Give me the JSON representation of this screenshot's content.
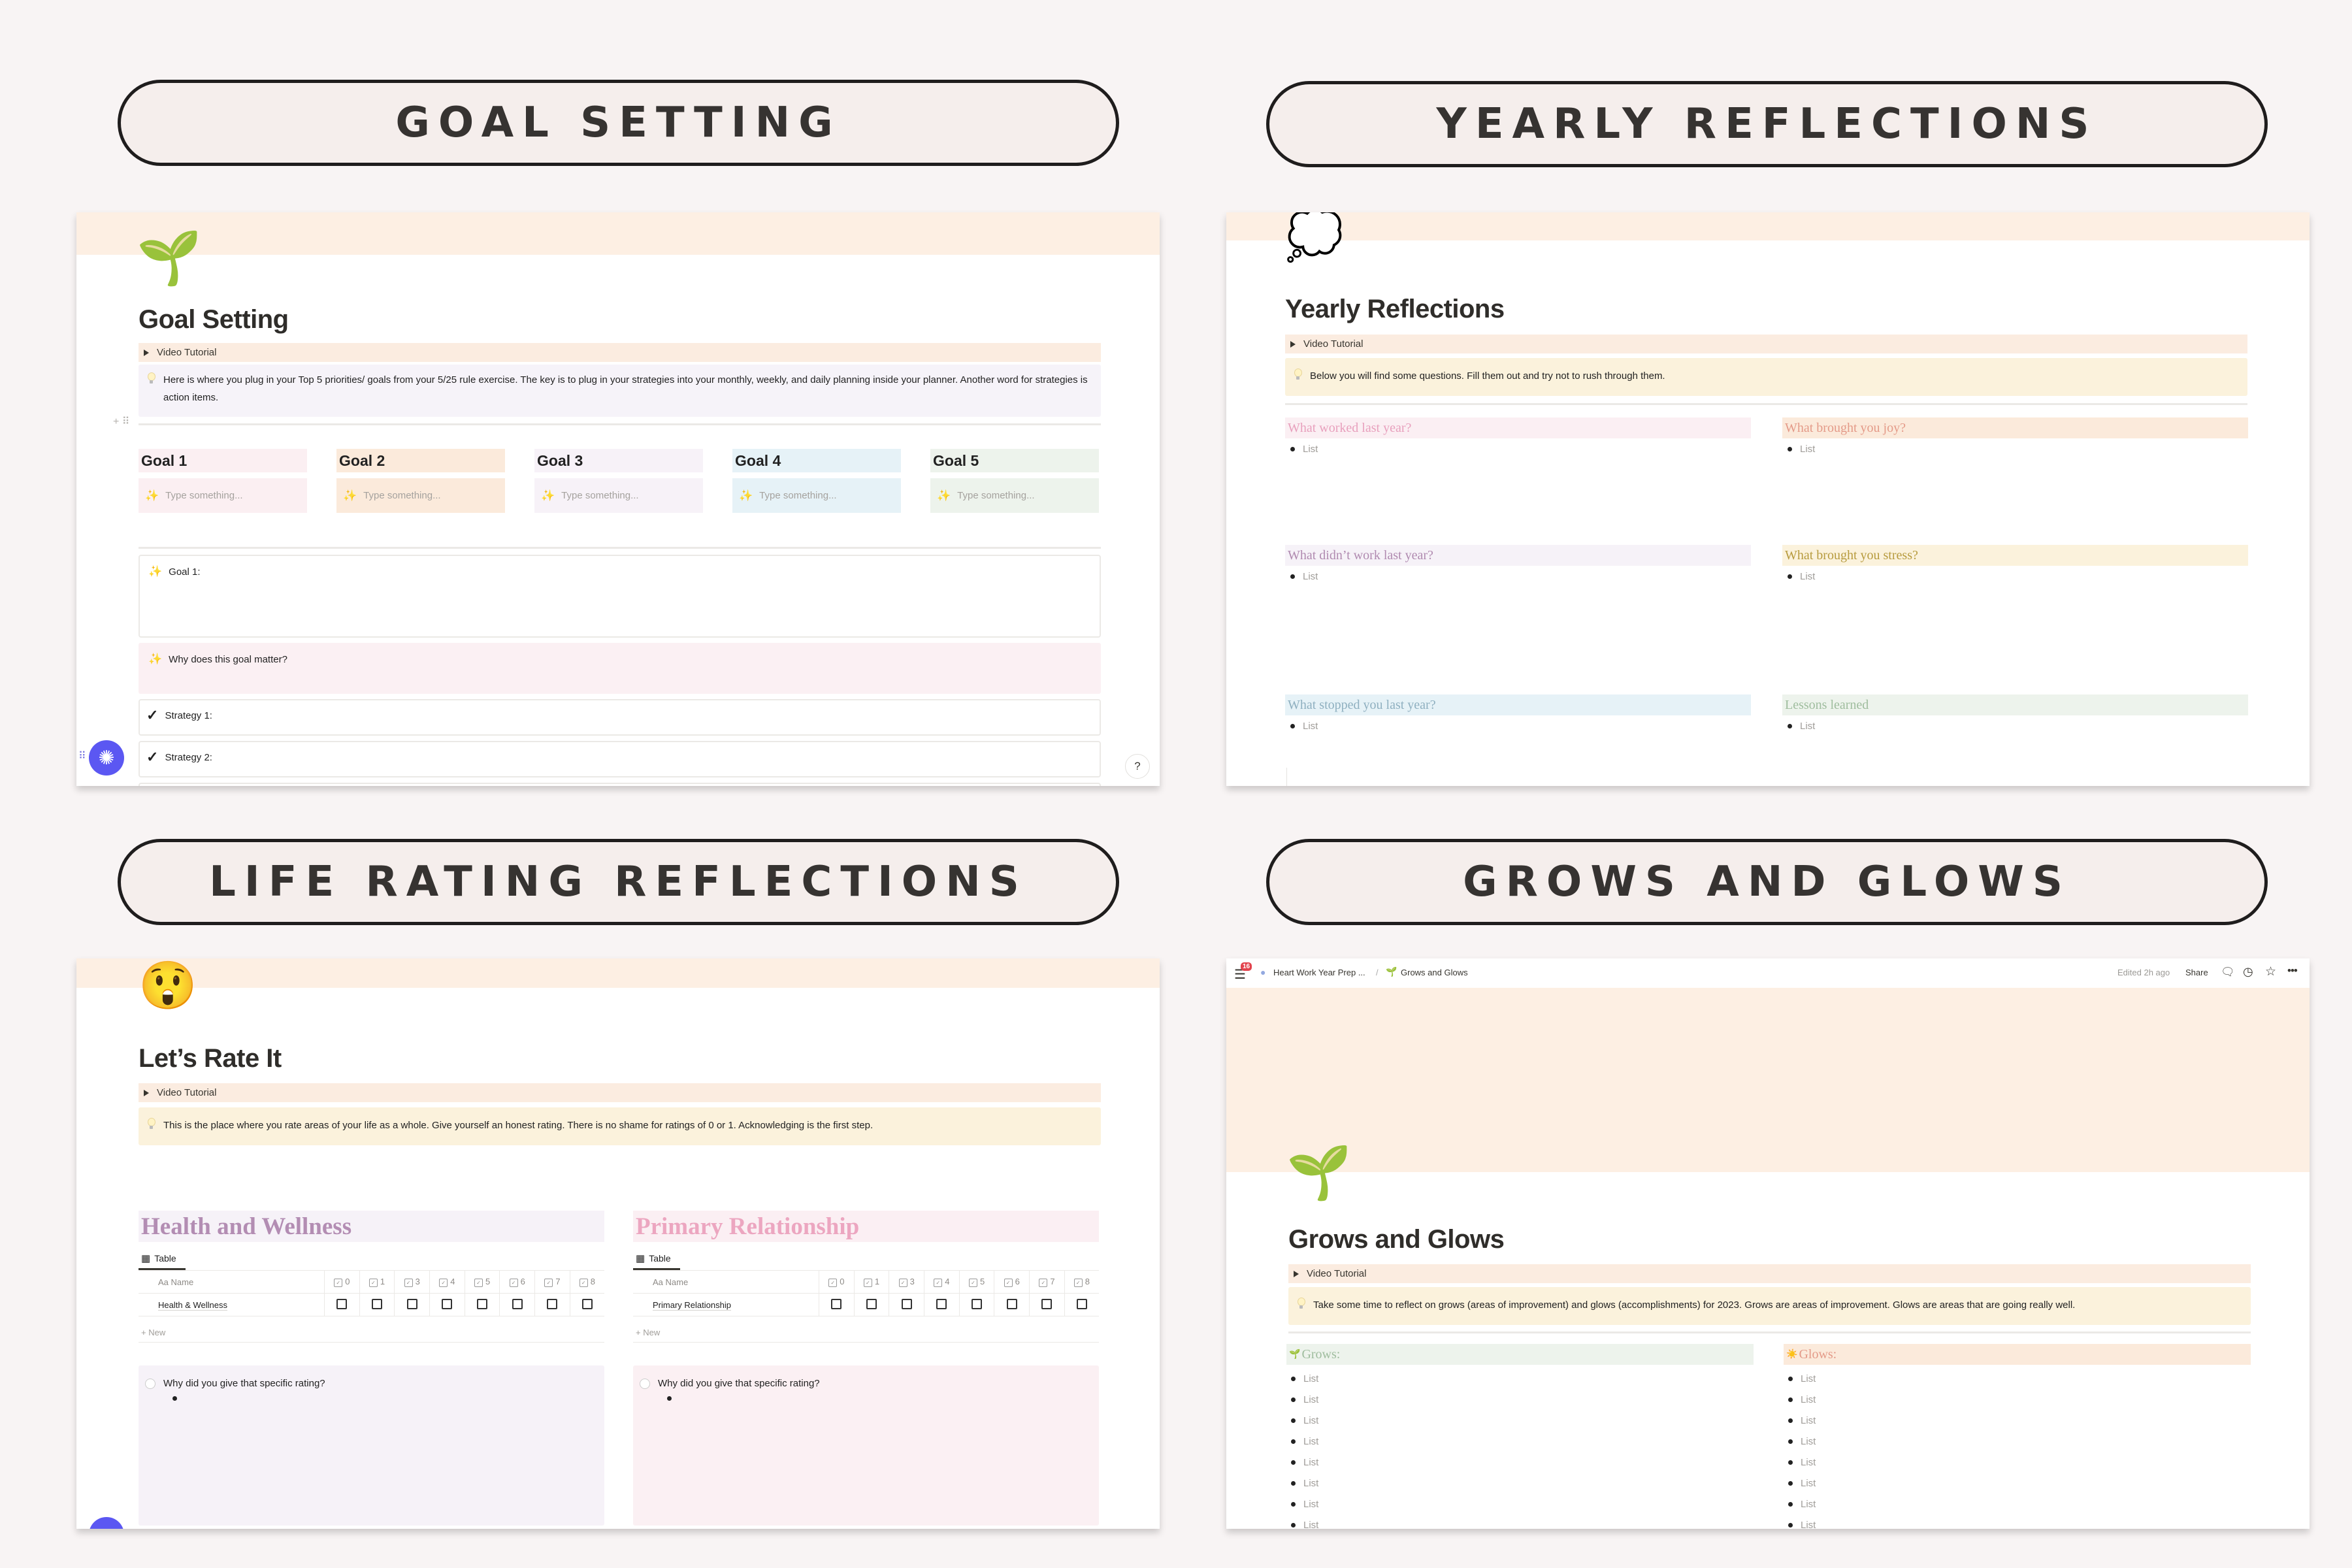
{
  "sections": {
    "goal_setting": "GOAL SETTING",
    "yearly_reflections": "YEARLY REFLECTIONS",
    "life_rating": "LIFE RATING REFLECTIONS",
    "grows_glows": "GROWS AND GLOWS"
  },
  "goal_page": {
    "icon": "seedling-icon",
    "title": "Goal Setting",
    "toggle": "Video Tutorial",
    "callout": "Here is where you plug in your Top 5 priorities/ goals from your 5/25 rule exercise. The key is to plug in your strategies into your monthly, weekly, and daily planning inside your planner. Another word for strategies is action items.",
    "goals": [
      {
        "label": "Goal 1",
        "placeholder": "Type something...",
        "color": "#fbeff2"
      },
      {
        "label": "Goal 2",
        "placeholder": "Type something...",
        "color": "#fbeadb"
      },
      {
        "label": "Goal 3",
        "placeholder": "Type something...",
        "color": "#f7f2f8"
      },
      {
        "label": "Goal 4",
        "placeholder": "Type something...",
        "color": "#e6f2f7"
      },
      {
        "label": "Goal 5",
        "placeholder": "Type something...",
        "color": "#edf3ec"
      }
    ],
    "goal1_label": "Goal 1:",
    "why_label": "Why does this goal matter?",
    "strategies": [
      "Strategy 1:",
      "Strategy 2:"
    ],
    "help": "?"
  },
  "yearly_page": {
    "icon": "thought-balloon-icon",
    "title": "Yearly Reflections",
    "toggle": "Video Tutorial",
    "callout": "Below you will find some questions. Fill them out and try not to rush through them.",
    "questions": [
      {
        "label": "What worked last year?",
        "item": "List",
        "color": "#e8a0bd",
        "bg": "#fbeff3"
      },
      {
        "label": "What brought you joy?",
        "item": "List",
        "color": "#e49a88",
        "bg": "#fbeadb"
      },
      {
        "label": "What didn’t work last year?",
        "item": "List",
        "color": "#b08ab0",
        "bg": "#f6f2f8"
      },
      {
        "label": "What brought you stress?",
        "item": "List",
        "color": "#b79b3e",
        "bg": "#fbf2dc"
      },
      {
        "label": "What stopped you last year?",
        "item": "List",
        "color": "#8fb0c0",
        "bg": "#e6f2f7"
      },
      {
        "label": "Lessons learned",
        "item": "List",
        "color": "#9fbd9e",
        "bg": "#edf3ec"
      }
    ]
  },
  "rate_page": {
    "icon": "astonished-face-icon",
    "title": "Let’s Rate It",
    "toggle": "Video Tutorial",
    "callout": "This is the place where you rate areas of your life as a whole. Give yourself an honest rating. There is no shame for ratings of 0 or 1. Acknowledging is the first step.",
    "databases": [
      {
        "heading": "Health and Wellness",
        "color": "#b38db3",
        "bg": "#f6f2f8",
        "view": "Table",
        "name_col": "Aa Name",
        "columns": [
          "0",
          "1",
          "3",
          "4",
          "5",
          "6",
          "7",
          "8"
        ],
        "row": "Health & Wellness",
        "new": "+ New",
        "why": "Why did you give that specific rating?",
        "why_bg": "#f6f2f8"
      },
      {
        "heading": "Primary Relationship",
        "color": "#eca6c0",
        "bg": "#fbeff3",
        "view": "Table",
        "name_col": "Aa Name",
        "columns": [
          "0",
          "1",
          "3",
          "4",
          "5",
          "6",
          "7",
          "8"
        ],
        "row": "Primary Relationship",
        "new": "+ New",
        "why": "Why did you give that specific rating?",
        "why_bg": "#fbf0f3"
      }
    ]
  },
  "grows_page": {
    "topbar": {
      "notifications": "16",
      "breadcrumb_parent": "Heart Work Year Prep ...",
      "separator": "/",
      "breadcrumb_current": "Grows and Glows",
      "edited": "Edited 2h ago",
      "share": "Share"
    },
    "icon": "seedling-icon",
    "title": "Grows and Glows",
    "toggle": "Video Tutorial",
    "callout": "Take some time to reflect on grows (areas of improvement) and glows (accomplishments) for 2023. Grows are areas of improvement. Glows are areas that are going really well.",
    "grows": {
      "label": "Grows:",
      "items": [
        "List",
        "List",
        "List",
        "List",
        "List",
        "List",
        "List",
        "List"
      ]
    },
    "glows": {
      "label": "Glows:",
      "items": [
        "List",
        "List",
        "List",
        "List",
        "List",
        "List",
        "List",
        "List"
      ]
    }
  }
}
